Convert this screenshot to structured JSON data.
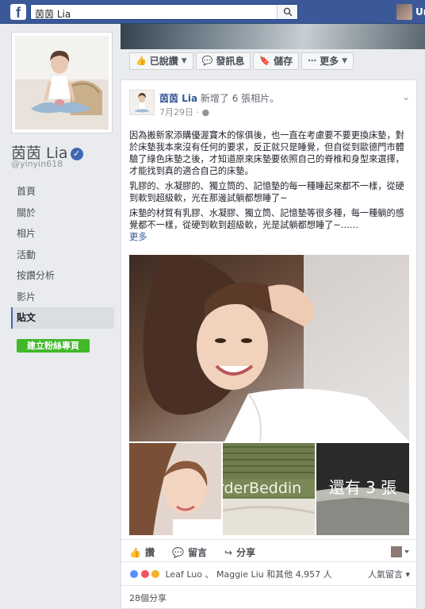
{
  "topbar": {
    "logo": "f",
    "search_value": "茵茵 Lia",
    "user_name": "Ur"
  },
  "profile": {
    "name": "茵茵 Lia",
    "handle": "@yinyin618",
    "nav": [
      "首頁",
      "關於",
      "相片",
      "活動",
      "按讚分析",
      "影片",
      "貼文"
    ],
    "active_nav": "貼文",
    "create_page_label": "建立粉絲專頁"
  },
  "actions": {
    "liked": "已說讚",
    "message": "發訊息",
    "save": "儲存",
    "more": "更多"
  },
  "post": {
    "author": "茵茵 Lia",
    "action": "新增了 6 張相片。",
    "date": "7月29日 ·",
    "paragraph1": "因為搬新家添購優渥寶木的傢俱後，也一直在考慮要不要更換床墊，對於床墊我本來沒有任何的要求，反正就只是睡覺，但自從到歐德門市體驗了綠色床墊之後，才知道原來床墊要依照自己的脊椎和身型來選擇，才能找到真的適合自己的床墊。",
    "paragraph2": "乳膠的、水凝膠的、獨立筒的、記憶墊的每一種睡起來都不一樣，從硬到軟到超級軟，光在那邊試躺都想睡了~",
    "paragraph3": "床墊的材質有乳膠、水凝膠、獨立筒、記憶墊等很多種，每一種躺的感覺都不一樣，從硬到軟到超級軟，光是試躺都想睡了~……",
    "more_link": "更多",
    "thumb2_text": "rderBeddin",
    "more_photos": "還有 3 張",
    "like_label": "讚",
    "comment_label": "留言",
    "share_label": "分享",
    "reaction_summary": "Leaf Luo 、 Maggie Liu 和其他 4,957 人",
    "top_comments": "人氣留言",
    "shares": "28個分享"
  },
  "colors": {
    "brand": "#3b5998",
    "link": "#365899",
    "green": "#42b72a"
  }
}
